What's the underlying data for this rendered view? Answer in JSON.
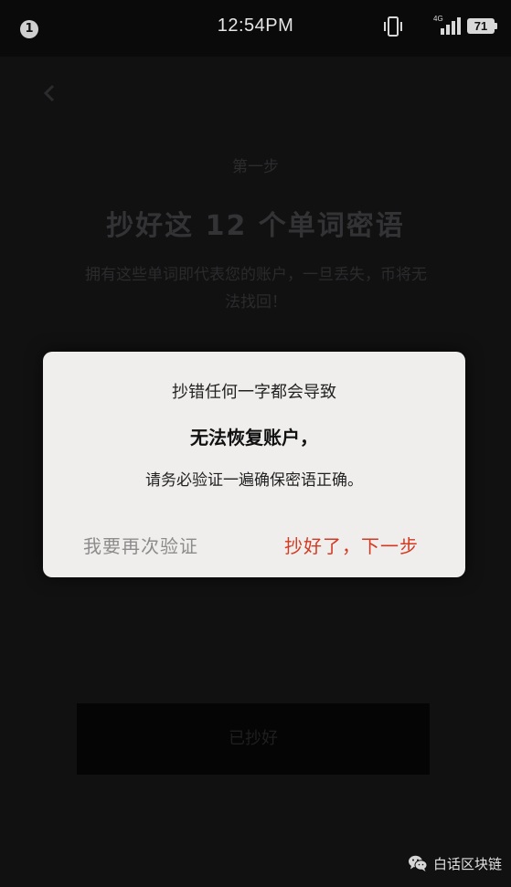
{
  "status_bar": {
    "notification_count": "1",
    "time": "12:54PM",
    "network_type": "4G",
    "battery_level": "71"
  },
  "background": {
    "step_label": "第一步",
    "title": "抄好这 12 个单词密语",
    "description": "拥有这些单词即代表您的账户，一旦丢失，币将无法找回！",
    "primary_button": "已抄好",
    "back_label": "",
    "nav_right": ""
  },
  "dialog": {
    "line1": "抄错任何一字都会导致",
    "line2": "无法恢复账户，",
    "line3": "请务必验证一遍确保密语正确。",
    "secondary_button": "我要再次验证",
    "primary_button": "抄好了，下一步",
    "primary_color": "#d23a22",
    "secondary_color": "#8c8c8c"
  },
  "watermark": {
    "icon": "wechat-icon",
    "text": "白话区块链"
  }
}
